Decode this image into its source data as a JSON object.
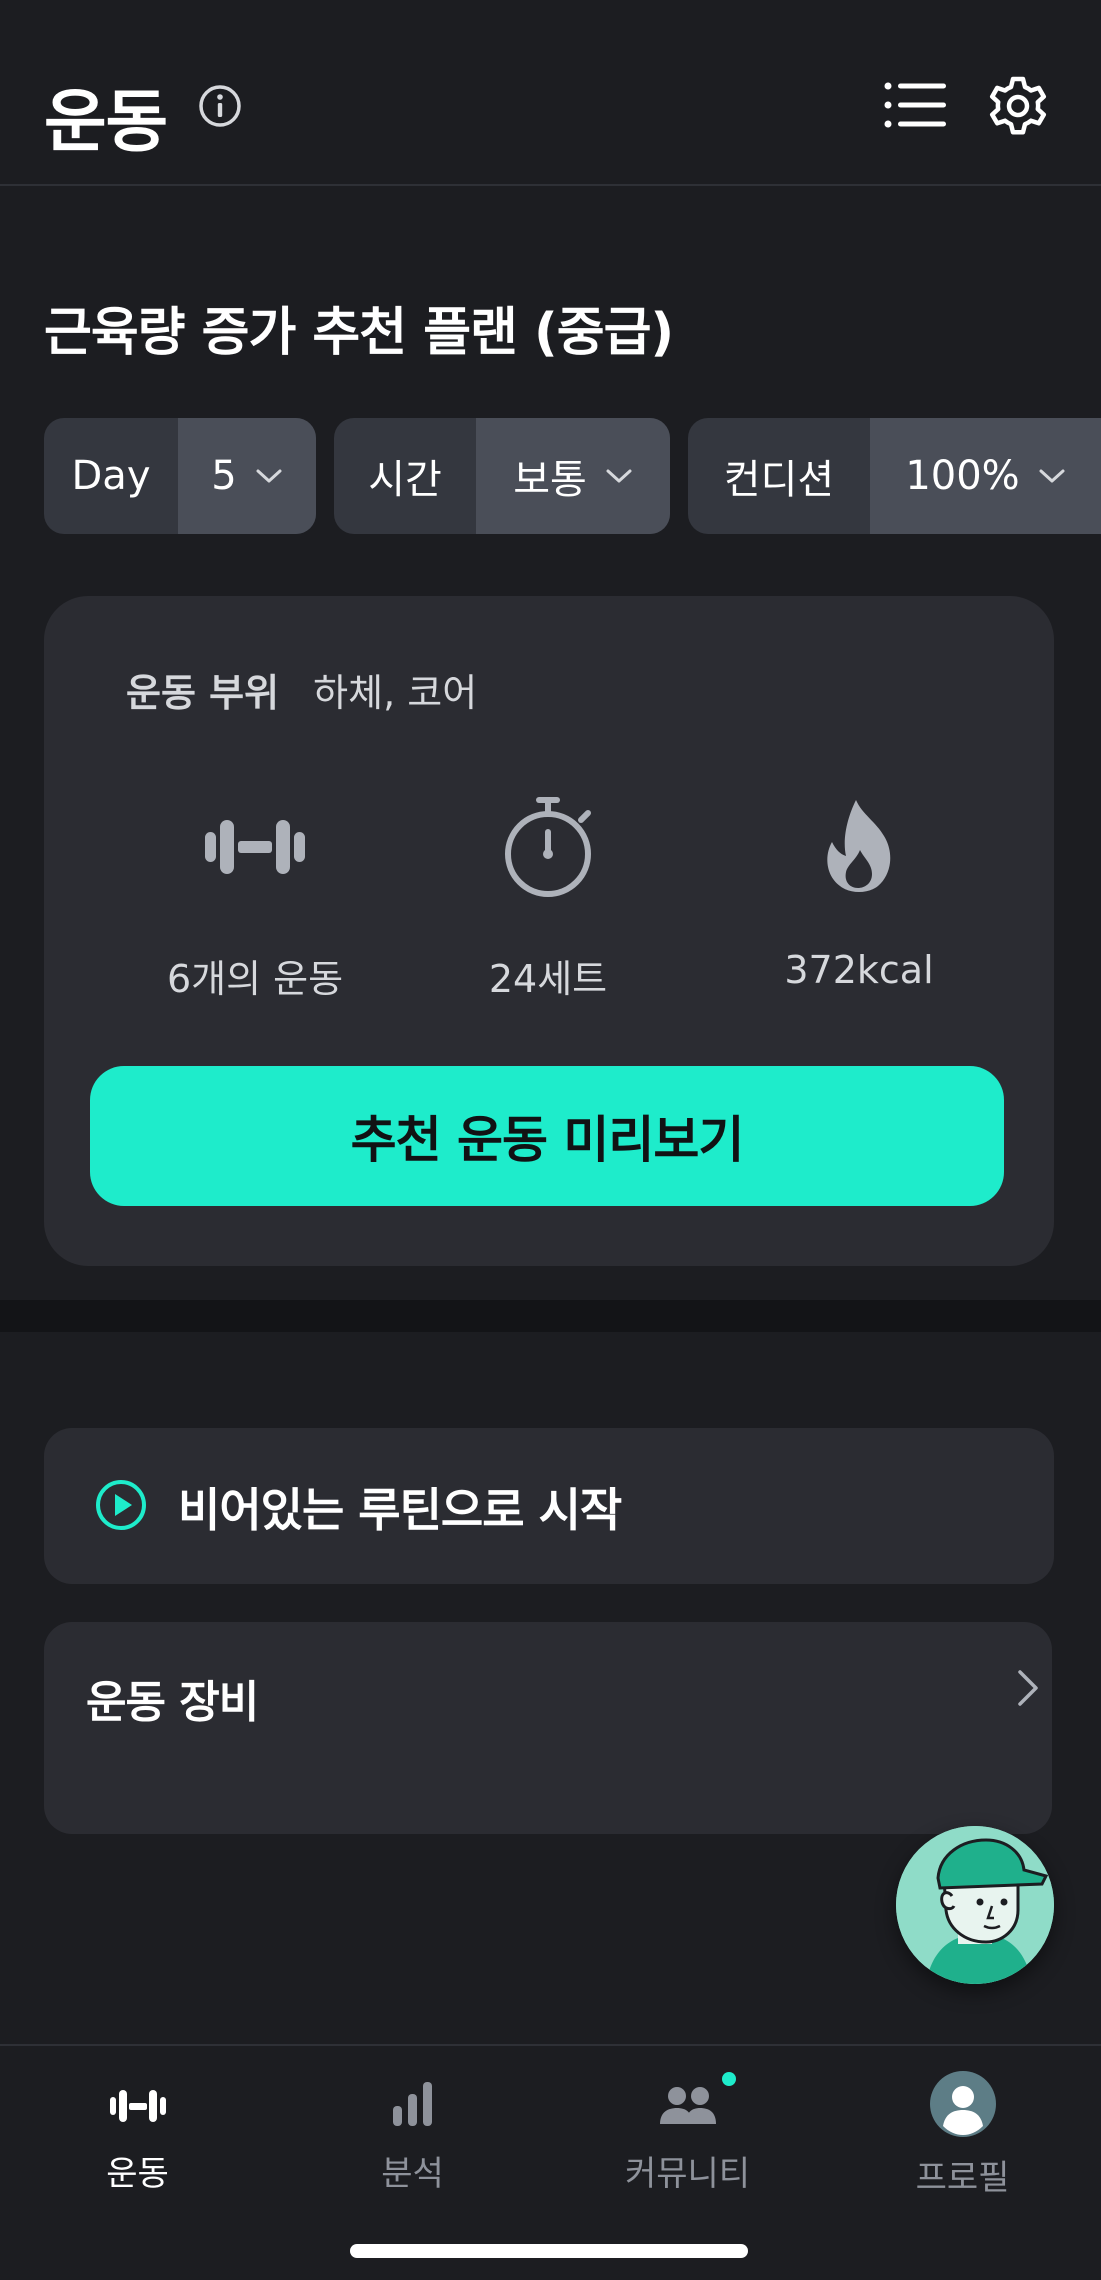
{
  "header": {
    "title": "운동",
    "info_icon": "info-icon",
    "list_icon": "list-icon",
    "settings_icon": "gear-icon"
  },
  "plan": {
    "title": "근육량 증가 추천 플랜 (중급)"
  },
  "selectors": {
    "day": {
      "label": "Day",
      "value": "5"
    },
    "time": {
      "label": "시간",
      "value": "보통"
    },
    "condition": {
      "label": "컨디션",
      "value": "100%"
    }
  },
  "card": {
    "part_label": "운동 부위",
    "part_value": "하체, 코어",
    "stats": {
      "exercises": "6개의 운동",
      "sets": "24세트",
      "calories": "372kcal"
    },
    "preview_button": "추천 운동 미리보기"
  },
  "routine": {
    "label": "비어있는 루틴으로 시작"
  },
  "equipment": {
    "label": "운동 장비"
  },
  "nav": {
    "items": [
      {
        "label": "운동",
        "icon": "dumbbell-icon",
        "active": true
      },
      {
        "label": "분석",
        "icon": "bar-chart-icon",
        "active": false
      },
      {
        "label": "커뮤니티",
        "icon": "people-icon",
        "active": false,
        "badge": true
      },
      {
        "label": "프로필",
        "icon": "profile-icon",
        "active": false
      }
    ]
  },
  "colors": {
    "background": "#1c1d21",
    "card": "#2b2c32",
    "accent": "#1eeccb",
    "selector": "#34373f",
    "selector_value": "#4a4e58",
    "muted_text": "#8e929b"
  }
}
